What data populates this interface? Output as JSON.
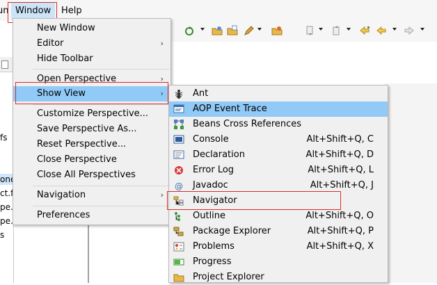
{
  "menubar": {
    "run_fragment": "un",
    "window_label": "Window",
    "help_label": "Help"
  },
  "toolbar": {
    "icons": [
      "refresh-run-icon",
      "open-folder-icon",
      "open-file-icon",
      "pen-icon",
      "open-folder-icon",
      "next-annotation-icon",
      "prev-annotation-icon",
      "last-edit-icon",
      "back-icon",
      "forward-icon"
    ]
  },
  "left_panel": {
    "fragments": [
      "fs",
      "one",
      "ct.fa",
      "pe.c",
      "pe.n",
      "s"
    ]
  },
  "window_menu": {
    "items": [
      {
        "label": "New Window",
        "has_submenu": false
      },
      {
        "label": "Editor",
        "has_submenu": true
      },
      {
        "label": "Hide Toolbar",
        "has_submenu": false
      },
      {
        "label": "Open Perspective",
        "has_submenu": true
      },
      {
        "label": "Show View",
        "has_submenu": true,
        "highlighted": true
      },
      {
        "label": "Customize Perspective...",
        "has_submenu": false
      },
      {
        "label": "Save Perspective As...",
        "has_submenu": false
      },
      {
        "label": "Reset Perspective...",
        "has_submenu": false
      },
      {
        "label": "Close Perspective",
        "has_submenu": false
      },
      {
        "label": "Close All Perspectives",
        "has_submenu": false
      },
      {
        "label": "Navigation",
        "has_submenu": true
      },
      {
        "label": "Preferences",
        "has_submenu": false
      }
    ],
    "submenu_arrow": "›"
  },
  "show_view_menu": {
    "items": [
      {
        "label": "Ant",
        "shortcut": "",
        "icon": "ant-icon"
      },
      {
        "label": "AOP Event Trace",
        "shortcut": "",
        "icon": "aop-event-trace-icon",
        "highlighted": true
      },
      {
        "label": "Beans Cross References",
        "shortcut": "",
        "icon": "beans-cross-references-icon"
      },
      {
        "label": "Console",
        "shortcut": "Alt+Shift+Q, C",
        "icon": "console-icon"
      },
      {
        "label": "Declaration",
        "shortcut": "Alt+Shift+Q, D",
        "icon": "declaration-icon"
      },
      {
        "label": "Error Log",
        "shortcut": "Alt+Shift+Q, L",
        "icon": "error-log-icon"
      },
      {
        "label": "Javadoc",
        "shortcut": "Alt+Shift+Q, J",
        "icon": "javadoc-icon"
      },
      {
        "label": "Navigator",
        "shortcut": "",
        "icon": "navigator-icon"
      },
      {
        "label": "Outline",
        "shortcut": "Alt+Shift+Q, O",
        "icon": "outline-icon"
      },
      {
        "label": "Package Explorer",
        "shortcut": "Alt+Shift+Q, P",
        "icon": "package-explorer-icon"
      },
      {
        "label": "Problems",
        "shortcut": "Alt+Shift+Q, X",
        "icon": "problems-icon"
      },
      {
        "label": "Progress",
        "shortcut": "",
        "icon": "progress-icon"
      },
      {
        "label": "Project Explorer",
        "shortcut": "",
        "icon": "project-explorer-icon"
      }
    ]
  },
  "colors": {
    "highlight": "#91c9f7",
    "annotation_red": "#d92b2b",
    "menu_bg": "#f0f0f0"
  }
}
